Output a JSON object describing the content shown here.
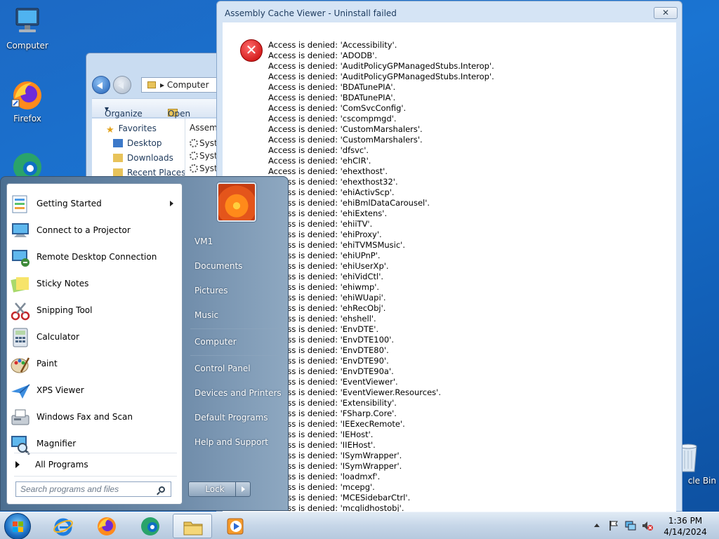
{
  "desktop": {
    "icons": [
      {
        "label": "Computer",
        "icon": "computer-icon"
      },
      {
        "label": "Firefox",
        "icon": "firefox-icon"
      },
      {
        "label": "",
        "icon": "edge-icon"
      },
      {
        "label": "cle Bin",
        "icon": "recycle-bin-icon"
      }
    ]
  },
  "explorer": {
    "address": "Computer",
    "toolbar": {
      "organize": "Organize",
      "open": "Open"
    },
    "nav": [
      "Favorites",
      "Desktop",
      "Downloads",
      "Recent Places"
    ],
    "column_header": "Assemb",
    "items": [
      "Syste",
      "Syste",
      "Syste"
    ]
  },
  "dialog": {
    "title": "Assembly Cache Viewer - Uninstall failed",
    "close_label": "✕",
    "messages": [
      "Access is denied: 'Accessibility'.",
      "Access is denied: 'ADODB'.",
      "Access is denied: 'AuditPolicyGPManagedStubs.Interop'.",
      "Access is denied: 'AuditPolicyGPManagedStubs.Interop'.",
      "Access is denied: 'BDATunePIA'.",
      "Access is denied: 'BDATunePIA'.",
      "Access is denied: 'ComSvcConfig'.",
      "Access is denied: 'cscompmgd'.",
      "Access is denied: 'CustomMarshalers'.",
      "Access is denied: 'CustomMarshalers'.",
      "Access is denied: 'dfsvc'.",
      "Access is denied: 'ehCIR'.",
      "Access is denied: 'ehexthost'.",
      "Access is denied: 'ehexthost32'.",
      "Access is denied: 'ehiActivScp'.",
      "Access is denied: 'ehiBmlDataCarousel'.",
      "Access is denied: 'ehiExtens'.",
      "Access is denied: 'ehiiTV'.",
      "Access is denied: 'ehiProxy'.",
      "Access is denied: 'ehiTVMSMusic'.",
      "Access is denied: 'ehiUPnP'.",
      "Access is denied: 'ehiUserXp'.",
      "Access is denied: 'ehiVidCtl'.",
      "Access is denied: 'ehiwmp'.",
      "Access is denied: 'ehiWUapi'.",
      "Access is denied: 'ehRecObj'.",
      "Access is denied: 'ehshell'.",
      "Access is denied: 'EnvDTE'.",
      "Access is denied: 'EnvDTE100'.",
      "Access is denied: 'EnvDTE80'.",
      "Access is denied: 'EnvDTE90'.",
      "Access is denied: 'EnvDTE90a'.",
      "Access is denied: 'EventViewer'.",
      "Access is denied: 'EventViewer.Resources'.",
      "Access is denied: 'Extensibility'.",
      "Access is denied: 'FSharp.Core'.",
      "Access is denied: 'IEExecRemote'.",
      "Access is denied: 'IEHost'.",
      "Access is denied: 'IIEHost'.",
      "Access is denied: 'ISymWrapper'.",
      "Access is denied: 'ISymWrapper'.",
      "Access is denied: 'loadmxf'.",
      "Access is denied: 'mcepg'.",
      "Access is denied: 'MCESidebarCtrl'.",
      "Access is denied: 'mcglidhostobj'."
    ]
  },
  "start_menu": {
    "programs": [
      {
        "label": "Getting Started",
        "icon": "getting-started-icon",
        "submenu": true
      },
      {
        "label": "Connect to a Projector",
        "icon": "projector-icon"
      },
      {
        "label": "Remote Desktop Connection",
        "icon": "remote-desktop-icon"
      },
      {
        "label": "Sticky Notes",
        "icon": "sticky-notes-icon"
      },
      {
        "label": "Snipping Tool",
        "icon": "snipping-tool-icon"
      },
      {
        "label": "Calculator",
        "icon": "calculator-icon"
      },
      {
        "label": "Paint",
        "icon": "paint-icon"
      },
      {
        "label": "XPS Viewer",
        "icon": "xps-viewer-icon"
      },
      {
        "label": "Windows Fax and Scan",
        "icon": "fax-scan-icon"
      },
      {
        "label": "Magnifier",
        "icon": "magnifier-icon"
      }
    ],
    "all_programs": "All Programs",
    "search_placeholder": "Search programs and files",
    "right_items": [
      "VM1",
      "Documents",
      "Pictures",
      "Music",
      "Computer",
      "Control Panel",
      "Devices and Printers",
      "Default Programs",
      "Help and Support"
    ],
    "lock_label": "Lock"
  },
  "taskbar": {
    "pinned": [
      "ie-icon",
      "firefox-icon",
      "edge-icon",
      "explorer-icon",
      "media-player-icon"
    ],
    "time": "1:36 PM",
    "date": "4/14/2024"
  }
}
